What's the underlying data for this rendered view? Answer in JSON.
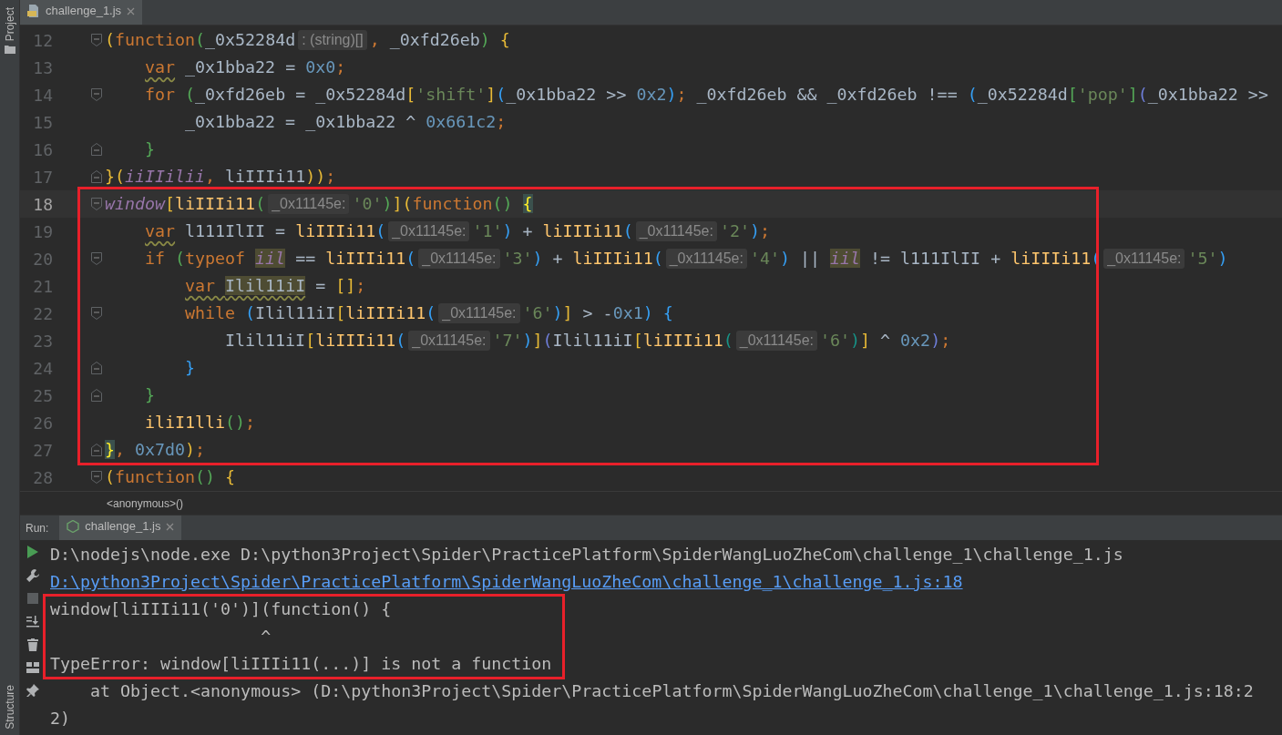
{
  "left_strip": {
    "top_label": "Project",
    "bottom_label": "Structure"
  },
  "editor": {
    "tabs": [
      {
        "label": "challenge_1.js",
        "selected": true
      }
    ],
    "lines": [
      {
        "number": "12",
        "current": false,
        "framed": false,
        "fold_start": true,
        "fold_end": false,
        "segments": [
          {
            "kind": "br",
            "text": "(",
            "color": "#e8ba36"
          },
          {
            "kind": "kw",
            "text": "function"
          },
          {
            "kind": "br",
            "text": "(",
            "color": "#54a857"
          },
          {
            "kind": "id",
            "text": "_0x52284d"
          },
          {
            "kind": "hint",
            "text": ": (string)[]"
          },
          {
            "kind": "punct",
            "text": ", "
          },
          {
            "kind": "id",
            "text": "_0xfd26eb"
          },
          {
            "kind": "br",
            "text": ")",
            "color": "#54a857"
          },
          {
            "kind": "br",
            "text": " {",
            "color": "#e8ba36"
          }
        ]
      },
      {
        "number": "13",
        "current": false,
        "framed": false,
        "fold_start": false,
        "fold_end": false,
        "segments": [
          {
            "kind": "kw",
            "text": "    var",
            "warning": true
          },
          {
            "kind": "id",
            "text": " _0x1bba22 = "
          },
          {
            "kind": "num",
            "text": "0x0"
          },
          {
            "kind": "punct",
            "text": ";"
          }
        ]
      },
      {
        "number": "14",
        "current": false,
        "framed": false,
        "fold_start": true,
        "fold_end": false,
        "segments": [
          {
            "kind": "kw",
            "text": "    for"
          },
          {
            "kind": "br",
            "text": " (",
            "color": "#54a857"
          },
          {
            "kind": "id",
            "text": "_0xfd26eb = _0x52284d"
          },
          {
            "kind": "br",
            "text": "[",
            "color": "#e8ba36"
          },
          {
            "kind": "str",
            "text": "'shift'"
          },
          {
            "kind": "br",
            "text": "]",
            "color": "#e8ba36"
          },
          {
            "kind": "br",
            "text": "(",
            "color": "#359ff4"
          },
          {
            "kind": "id",
            "text": "_0x1bba22 >> "
          },
          {
            "kind": "num",
            "text": "0x2"
          },
          {
            "kind": "br",
            "text": ")",
            "color": "#359ff4"
          },
          {
            "kind": "punct",
            "text": ";"
          },
          {
            "kind": "id",
            "text": " _0xfd26eb && _0xfd26eb !== "
          },
          {
            "kind": "br",
            "text": "(",
            "color": "#359ff4"
          },
          {
            "kind": "id",
            "text": "_0x52284d"
          },
          {
            "kind": "br",
            "text": "[",
            "color": "#54a857"
          },
          {
            "kind": "str",
            "text": "'pop'"
          },
          {
            "kind": "br",
            "text": "]",
            "color": "#54a857"
          },
          {
            "kind": "br",
            "text": "(",
            "color": "#6e7ed9"
          },
          {
            "kind": "id",
            "text": "_0x1bba22 >>"
          }
        ]
      },
      {
        "number": "15",
        "current": false,
        "framed": false,
        "fold_start": false,
        "fold_end": false,
        "segments": [
          {
            "kind": "id",
            "text": "        _0x1bba22 = _0x1bba22 ^ "
          },
          {
            "kind": "num",
            "text": "0x661c2"
          },
          {
            "kind": "punct",
            "text": ";"
          }
        ]
      },
      {
        "number": "16",
        "current": false,
        "framed": false,
        "fold_start": false,
        "fold_end": true,
        "segments": [
          {
            "kind": "br",
            "text": "    }",
            "color": "#54a857"
          }
        ]
      },
      {
        "number": "17",
        "current": false,
        "framed": false,
        "fold_start": false,
        "fold_end": true,
        "segments": [
          {
            "kind": "br",
            "text": "}",
            "color": "#e8ba36"
          },
          {
            "kind": "br",
            "text": "(",
            "color": "#e8ba36"
          },
          {
            "kind": "glob",
            "text": "iiIIilii"
          },
          {
            "kind": "punct",
            "text": ", "
          },
          {
            "kind": "id",
            "text": "liIIIi11"
          },
          {
            "kind": "br",
            "text": "))",
            "color": "#e8ba36"
          },
          {
            "kind": "punct",
            "text": ";"
          }
        ]
      },
      {
        "number": "18",
        "current": true,
        "framed": true,
        "fold_start": true,
        "fold_end": false,
        "segments": [
          {
            "kind": "glob",
            "text": "window"
          },
          {
            "kind": "br",
            "text": "[",
            "color": "#e8ba36"
          },
          {
            "kind": "fn",
            "text": "liIIIi11"
          },
          {
            "kind": "br",
            "text": "(",
            "color": "#54a857"
          },
          {
            "kind": "hint",
            "text": "_0x11145e:"
          },
          {
            "kind": "str",
            "text": "'0'"
          },
          {
            "kind": "br",
            "text": ")",
            "color": "#54a857"
          },
          {
            "kind": "br",
            "text": "]",
            "color": "#e8ba36"
          },
          {
            "kind": "br",
            "text": "(",
            "color": "#e8ba36"
          },
          {
            "kind": "kw",
            "text": "function"
          },
          {
            "kind": "br",
            "text": "() ",
            "color": "#54a857"
          },
          {
            "kind": "brace",
            "text": "{",
            "matched": true
          }
        ]
      },
      {
        "number": "19",
        "current": false,
        "framed": true,
        "fold_start": false,
        "fold_end": false,
        "segments": [
          {
            "kind": "kw",
            "text": "    var",
            "warning": true
          },
          {
            "kind": "id",
            "text": " l111IlII = "
          },
          {
            "kind": "fn",
            "text": "liIIIi11"
          },
          {
            "kind": "br",
            "text": "(",
            "color": "#359ff4"
          },
          {
            "kind": "hint",
            "text": "_0x11145e:"
          },
          {
            "kind": "str",
            "text": "'1'"
          },
          {
            "kind": "br",
            "text": ")",
            "color": "#359ff4"
          },
          {
            "kind": "id",
            "text": " + "
          },
          {
            "kind": "fn",
            "text": "liIIIi11"
          },
          {
            "kind": "br",
            "text": "(",
            "color": "#359ff4"
          },
          {
            "kind": "hint",
            "text": "_0x11145e:"
          },
          {
            "kind": "str",
            "text": "'2'"
          },
          {
            "kind": "br",
            "text": ")",
            "color": "#359ff4"
          },
          {
            "kind": "punct",
            "text": ";"
          }
        ]
      },
      {
        "number": "20",
        "current": false,
        "framed": true,
        "fold_start": true,
        "fold_end": false,
        "segments": [
          {
            "kind": "kw",
            "text": "    if"
          },
          {
            "kind": "br",
            "text": " (",
            "color": "#54a857"
          },
          {
            "kind": "kw",
            "text": "typeof "
          },
          {
            "kind": "glob",
            "text": "iil",
            "highlighted": true
          },
          {
            "kind": "id",
            "text": " == "
          },
          {
            "kind": "fn",
            "text": "liIIIi11"
          },
          {
            "kind": "br",
            "text": "(",
            "color": "#359ff4"
          },
          {
            "kind": "hint",
            "text": "_0x11145e:"
          },
          {
            "kind": "str",
            "text": "'3'"
          },
          {
            "kind": "br",
            "text": ")",
            "color": "#359ff4"
          },
          {
            "kind": "id",
            "text": " + "
          },
          {
            "kind": "fn",
            "text": "liIIIi11"
          },
          {
            "kind": "br",
            "text": "(",
            "color": "#359ff4"
          },
          {
            "kind": "hint",
            "text": "_0x11145e:"
          },
          {
            "kind": "str",
            "text": "'4'"
          },
          {
            "kind": "br",
            "text": ")",
            "color": "#359ff4"
          },
          {
            "kind": "id",
            "text": " || "
          },
          {
            "kind": "glob",
            "text": "iil",
            "highlighted": true
          },
          {
            "kind": "id",
            "text": " != l111IlII + "
          },
          {
            "kind": "fn",
            "text": "liIIIi11"
          },
          {
            "kind": "br",
            "text": "(",
            "color": "#359ff4"
          },
          {
            "kind": "hint",
            "text": "_0x11145e:"
          },
          {
            "kind": "str",
            "text": "'5'"
          },
          {
            "kind": "br",
            "text": ")",
            "color": "#359ff4"
          }
        ]
      },
      {
        "number": "21",
        "current": false,
        "framed": true,
        "fold_start": false,
        "fold_end": false,
        "segments": [
          {
            "kind": "kw",
            "text": "        var ",
            "warning": true
          },
          {
            "kind": "id",
            "text": "Ilil11iI",
            "highlighted": true,
            "warning": true
          },
          {
            "kind": "id",
            "text": " = "
          },
          {
            "kind": "br",
            "text": "[]",
            "color": "#e8ba36"
          },
          {
            "kind": "punct",
            "text": ";"
          }
        ]
      },
      {
        "number": "22",
        "current": false,
        "framed": true,
        "fold_start": true,
        "fold_end": false,
        "segments": [
          {
            "kind": "kw",
            "text": "        while"
          },
          {
            "kind": "br",
            "text": " (",
            "color": "#359ff4"
          },
          {
            "kind": "id",
            "text": "Ilil11iI"
          },
          {
            "kind": "br",
            "text": "[",
            "color": "#e8ba36"
          },
          {
            "kind": "fn",
            "text": "liIIIi11"
          },
          {
            "kind": "br",
            "text": "(",
            "color": "#359ff4"
          },
          {
            "kind": "hint",
            "text": "_0x11145e:"
          },
          {
            "kind": "str",
            "text": "'6'"
          },
          {
            "kind": "br",
            "text": ")",
            "color": "#359ff4"
          },
          {
            "kind": "br",
            "text": "]",
            "color": "#e8ba36"
          },
          {
            "kind": "id",
            "text": " > -"
          },
          {
            "kind": "num",
            "text": "0x1"
          },
          {
            "kind": "br",
            "text": ")",
            "color": "#359ff4"
          },
          {
            "kind": "br",
            "text": " {",
            "color": "#359ff4"
          }
        ]
      },
      {
        "number": "23",
        "current": false,
        "framed": true,
        "fold_start": false,
        "fold_end": false,
        "segments": [
          {
            "kind": "id",
            "text": "            Ilil11iI"
          },
          {
            "kind": "br",
            "text": "[",
            "color": "#e8ba36"
          },
          {
            "kind": "fn",
            "text": "liIIIi11"
          },
          {
            "kind": "br",
            "text": "(",
            "color": "#359ff4"
          },
          {
            "kind": "hint",
            "text": "_0x11145e:"
          },
          {
            "kind": "str",
            "text": "'7'"
          },
          {
            "kind": "br",
            "text": ")",
            "color": "#359ff4"
          },
          {
            "kind": "br",
            "text": "]",
            "color": "#e8ba36"
          },
          {
            "kind": "br",
            "text": "(",
            "color": "#6e7ed9"
          },
          {
            "kind": "id",
            "text": "Ilil11iI"
          },
          {
            "kind": "br",
            "text": "[",
            "color": "#e8ba36"
          },
          {
            "kind": "fn",
            "text": "liIIIi11"
          },
          {
            "kind": "br",
            "text": "(",
            "color": "#179387"
          },
          {
            "kind": "hint",
            "text": "_0x11145e:"
          },
          {
            "kind": "str",
            "text": "'6'"
          },
          {
            "kind": "br",
            "text": ")",
            "color": "#179387"
          },
          {
            "kind": "br",
            "text": "]",
            "color": "#e8ba36"
          },
          {
            "kind": "id",
            "text": " ^ "
          },
          {
            "kind": "num",
            "text": "0x2"
          },
          {
            "kind": "br",
            "text": ")",
            "color": "#6e7ed9"
          },
          {
            "kind": "punct",
            "text": ";"
          }
        ]
      },
      {
        "number": "24",
        "current": false,
        "framed": true,
        "fold_start": false,
        "fold_end": true,
        "segments": [
          {
            "kind": "br",
            "text": "        }",
            "color": "#359ff4"
          }
        ]
      },
      {
        "number": "25",
        "current": false,
        "framed": true,
        "fold_start": false,
        "fold_end": true,
        "segments": [
          {
            "kind": "br",
            "text": "    }",
            "color": "#54a857"
          }
        ]
      },
      {
        "number": "26",
        "current": false,
        "framed": true,
        "fold_start": false,
        "fold_end": false,
        "segments": [
          {
            "kind": "fn",
            "text": "    iliI1lli"
          },
          {
            "kind": "br",
            "text": "()",
            "color": "#54a857"
          },
          {
            "kind": "punct",
            "text": ";"
          }
        ]
      },
      {
        "number": "27",
        "current": false,
        "framed": true,
        "fold_start": false,
        "fold_end": true,
        "segments": [
          {
            "kind": "brace",
            "text": "}",
            "matched": true
          },
          {
            "kind": "punct",
            "text": ", "
          },
          {
            "kind": "num",
            "text": "0x7d0"
          },
          {
            "kind": "br",
            "text": ")",
            "color": "#e8ba36"
          },
          {
            "kind": "punct",
            "text": ";"
          }
        ]
      },
      {
        "number": "28",
        "current": false,
        "framed": false,
        "fold_start": true,
        "fold_end": false,
        "segments": [
          {
            "kind": "br",
            "text": "(",
            "color": "#e8ba36"
          },
          {
            "kind": "kw",
            "text": "function"
          },
          {
            "kind": "br",
            "text": "() ",
            "color": "#54a857"
          },
          {
            "kind": "br",
            "text": "{",
            "color": "#e8ba36"
          }
        ]
      }
    ],
    "breadcrumb": "<anonymous>()"
  },
  "run": {
    "label": "Run:",
    "tabs": [
      {
        "label": "challenge_1.js",
        "selected": true
      }
    ],
    "output": [
      {
        "kind": "plain",
        "framed": false,
        "text": "D:\\nodejs\\node.exe D:\\python3Project\\Spider\\PracticePlatform\\SpiderWangLuoZheCom\\challenge_1\\challenge_1.js"
      },
      {
        "kind": "link",
        "framed": false,
        "text": "D:\\python3Project\\Spider\\PracticePlatform\\SpiderWangLuoZheCom\\challenge_1\\challenge_1.js:18"
      },
      {
        "kind": "plain",
        "framed": true,
        "text": "window[liIIIi11('0')](function() {"
      },
      {
        "kind": "plain",
        "framed": true,
        "text": "                     ^"
      },
      {
        "kind": "plain",
        "framed": true,
        "text": "TypeError: window[liIIIi11(...)] is not a function"
      },
      {
        "kind": "plain",
        "framed": false,
        "text": "    at Object.<anonymous> (D:\\python3Project\\Spider\\PracticePlatform\\SpiderWangLuoZheCom\\challenge_1\\challenge_1.js:18:22)"
      }
    ]
  }
}
